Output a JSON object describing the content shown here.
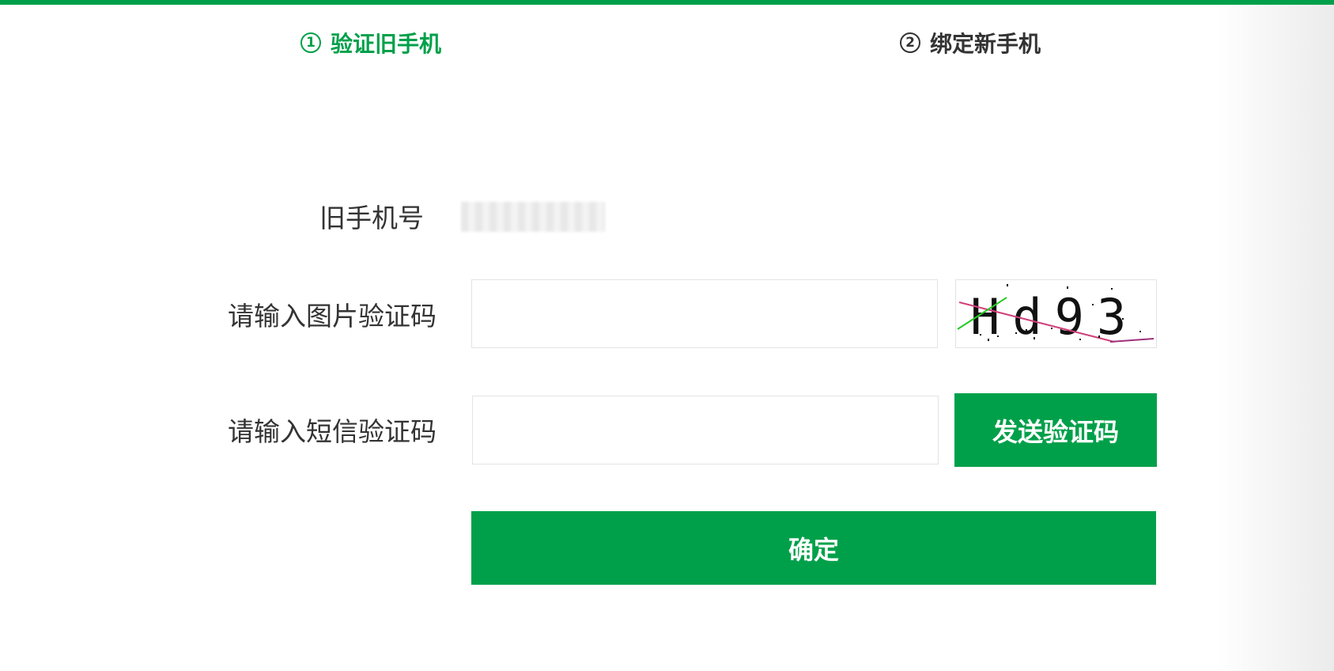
{
  "steps": [
    {
      "number": "1",
      "label": "验证旧手机",
      "active": true
    },
    {
      "number": "2",
      "label": "绑定新手机",
      "active": false
    }
  ],
  "form": {
    "old_phone_label": "旧手机号",
    "old_phone_value_masked": true,
    "image_code_label": "请输入图片验证码",
    "image_code_value": "",
    "captcha_text": "Hd93",
    "sms_code_label": "请输入短信验证码",
    "sms_code_value": "",
    "send_code_button": "发送验证码",
    "confirm_button": "确定"
  },
  "colors": {
    "accent": "#00a04a",
    "text": "#333333",
    "border": "#e3e3e3"
  }
}
